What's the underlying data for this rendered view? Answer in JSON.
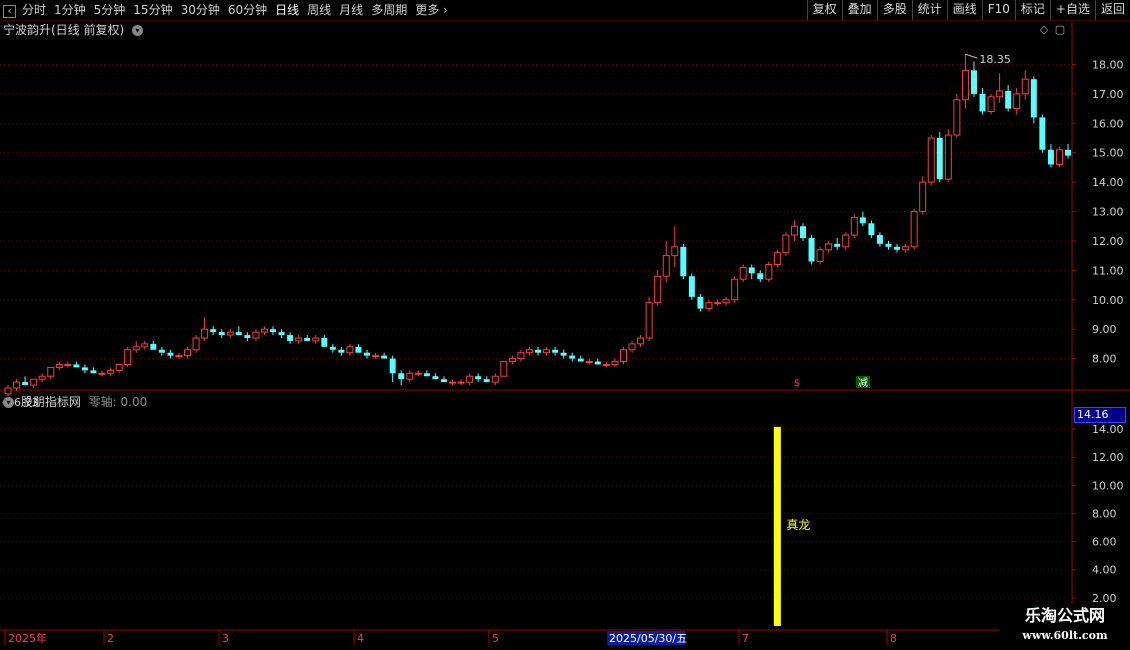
{
  "toolbar": {
    "periods": [
      "分时",
      "1分钟",
      "5分钟",
      "15分钟",
      "30分钟",
      "60分钟",
      "日线",
      "周线",
      "月线",
      "多周期",
      "更多"
    ],
    "active_period": "日线",
    "more_arrow": "›",
    "buttons": [
      "复权",
      "叠加",
      "多股",
      "统计",
      "画线",
      "F10",
      "标记",
      "+自选",
      "返回"
    ]
  },
  "chart": {
    "title": "宁波韵升(日线 前复权)",
    "high_label": "18.35",
    "low_label": "6.73",
    "signal_marks": [
      "$",
      "减"
    ],
    "price_ticks": [
      "18.00",
      "17.00",
      "16.00",
      "15.00",
      "14.00",
      "13.00",
      "12.00",
      "11.00",
      "10.00",
      "9.00",
      "8.00"
    ]
  },
  "indicator": {
    "title": "股朋指标网",
    "zero_axis": "零轴: 0.00",
    "bar_label": "真龙",
    "current_value": "14.16",
    "ticks": [
      "14.00",
      "12.00",
      "10.00",
      "8.00",
      "6.00",
      "4.00",
      "2.00"
    ]
  },
  "time_axis": {
    "labels": [
      "2025年",
      "2",
      "3",
      "4",
      "5",
      "7",
      "8"
    ],
    "highlighted_date": "2025/05/30/五"
  },
  "watermark": {
    "line1": "乐淘公式网",
    "line2": "www.60lt.com"
  },
  "colors": {
    "up": "#ff3c3c",
    "down": "#54ffff",
    "grid": "#5a0000",
    "signal_bar": "#ffff00",
    "label": "#ffff00"
  },
  "chart_data": {
    "type": "candlestick",
    "title": "宁波韵升(日线 前复权)",
    "ylim": [
      7.0,
      18.9
    ],
    "candles": [
      [
        6.8,
        7.1,
        6.73,
        7.0
      ],
      [
        7.0,
        7.3,
        6.9,
        7.2
      ],
      [
        7.2,
        7.4,
        7.1,
        7.1
      ],
      [
        7.1,
        7.3,
        7.0,
        7.3
      ],
      [
        7.3,
        7.5,
        7.2,
        7.4
      ],
      [
        7.4,
        7.7,
        7.3,
        7.7
      ],
      [
        7.7,
        7.9,
        7.6,
        7.8
      ],
      [
        7.8,
        7.9,
        7.7,
        7.8
      ],
      [
        7.8,
        7.9,
        7.7,
        7.7
      ],
      [
        7.7,
        7.8,
        7.5,
        7.6
      ],
      [
        7.6,
        7.7,
        7.5,
        7.5
      ],
      [
        7.5,
        7.6,
        7.4,
        7.5
      ],
      [
        7.5,
        7.7,
        7.4,
        7.6
      ],
      [
        7.6,
        7.8,
        7.5,
        7.8
      ],
      [
        7.8,
        8.4,
        7.7,
        8.3
      ],
      [
        8.3,
        8.6,
        8.2,
        8.4
      ],
      [
        8.4,
        8.6,
        8.3,
        8.5
      ],
      [
        8.5,
        8.6,
        8.3,
        8.3
      ],
      [
        8.3,
        8.4,
        8.1,
        8.2
      ],
      [
        8.2,
        8.3,
        8.0,
        8.1
      ],
      [
        8.1,
        8.2,
        8.0,
        8.1
      ],
      [
        8.1,
        8.4,
        8.0,
        8.3
      ],
      [
        8.3,
        8.8,
        8.2,
        8.7
      ],
      [
        8.7,
        9.4,
        8.6,
        9.0
      ],
      [
        9.0,
        9.1,
        8.8,
        8.9
      ],
      [
        8.9,
        9.0,
        8.7,
        8.8
      ],
      [
        8.8,
        9.0,
        8.7,
        8.9
      ],
      [
        8.9,
        9.1,
        8.8,
        8.8
      ],
      [
        8.8,
        8.9,
        8.6,
        8.7
      ],
      [
        8.7,
        9.0,
        8.6,
        8.9
      ],
      [
        8.9,
        9.1,
        8.8,
        9.0
      ],
      [
        9.0,
        9.1,
        8.8,
        8.9
      ],
      [
        8.9,
        9.0,
        8.7,
        8.8
      ],
      [
        8.8,
        8.9,
        8.5,
        8.6
      ],
      [
        8.6,
        8.8,
        8.5,
        8.7
      ],
      [
        8.7,
        8.8,
        8.6,
        8.6
      ],
      [
        8.6,
        8.8,
        8.5,
        8.7
      ],
      [
        8.7,
        8.8,
        8.4,
        8.4
      ],
      [
        8.4,
        8.5,
        8.2,
        8.3
      ],
      [
        8.3,
        8.4,
        8.1,
        8.2
      ],
      [
        8.2,
        8.5,
        8.1,
        8.4
      ],
      [
        8.4,
        8.5,
        8.2,
        8.2
      ],
      [
        8.2,
        8.3,
        8.0,
        8.1
      ],
      [
        8.1,
        8.2,
        8.0,
        8.1
      ],
      [
        8.1,
        8.2,
        8.0,
        8.0
      ],
      [
        8.0,
        8.1,
        7.2,
        7.5
      ],
      [
        7.5,
        7.6,
        7.1,
        7.3
      ],
      [
        7.3,
        7.6,
        7.2,
        7.5
      ],
      [
        7.5,
        7.6,
        7.4,
        7.5
      ],
      [
        7.5,
        7.6,
        7.4,
        7.4
      ],
      [
        7.4,
        7.5,
        7.3,
        7.3
      ],
      [
        7.3,
        7.4,
        7.2,
        7.2
      ],
      [
        7.2,
        7.3,
        7.1,
        7.2
      ],
      [
        7.2,
        7.3,
        7.1,
        7.2
      ],
      [
        7.2,
        7.5,
        7.1,
        7.4
      ],
      [
        7.4,
        7.5,
        7.2,
        7.3
      ],
      [
        7.3,
        7.4,
        7.2,
        7.2
      ],
      [
        7.2,
        7.5,
        7.1,
        7.4
      ],
      [
        7.4,
        7.9,
        7.4,
        7.9
      ],
      [
        7.9,
        8.1,
        7.8,
        8.0
      ],
      [
        8.0,
        8.3,
        7.9,
        8.2
      ],
      [
        8.2,
        8.4,
        8.1,
        8.3
      ],
      [
        8.3,
        8.4,
        8.1,
        8.2
      ],
      [
        8.2,
        8.4,
        8.1,
        8.3
      ],
      [
        8.3,
        8.4,
        8.1,
        8.2
      ],
      [
        8.2,
        8.3,
        8.0,
        8.1
      ],
      [
        8.1,
        8.2,
        7.9,
        8.0
      ],
      [
        8.0,
        8.1,
        7.9,
        7.9
      ],
      [
        7.9,
        8.0,
        7.8,
        7.9
      ],
      [
        7.9,
        8.0,
        7.8,
        7.8
      ],
      [
        7.8,
        7.9,
        7.7,
        7.8
      ],
      [
        7.8,
        8.0,
        7.7,
        7.9
      ],
      [
        7.9,
        8.4,
        7.8,
        8.3
      ],
      [
        8.3,
        8.6,
        8.2,
        8.5
      ],
      [
        8.5,
        8.8,
        8.4,
        8.7
      ],
      [
        8.7,
        10.1,
        8.6,
        9.9
      ],
      [
        9.9,
        11.0,
        9.8,
        10.8
      ],
      [
        10.8,
        12.0,
        10.6,
        11.5
      ],
      [
        11.5,
        12.5,
        11.1,
        11.8
      ],
      [
        11.8,
        11.9,
        10.7,
        10.8
      ],
      [
        10.8,
        10.9,
        10.0,
        10.1
      ],
      [
        10.1,
        10.2,
        9.6,
        9.7
      ],
      [
        9.7,
        10.0,
        9.6,
        9.9
      ],
      [
        9.9,
        10.0,
        9.8,
        9.9
      ],
      [
        9.9,
        10.1,
        9.8,
        10.0
      ],
      [
        10.0,
        10.8,
        9.9,
        10.7
      ],
      [
        10.7,
        11.2,
        10.6,
        11.1
      ],
      [
        11.1,
        11.2,
        10.7,
        10.9
      ],
      [
        10.9,
        11.0,
        10.6,
        10.7
      ],
      [
        10.7,
        11.3,
        10.6,
        11.2
      ],
      [
        11.2,
        11.7,
        11.1,
        11.6
      ],
      [
        11.6,
        12.3,
        11.5,
        12.2
      ],
      [
        12.2,
        12.7,
        12.0,
        12.5
      ],
      [
        12.5,
        12.6,
        12.0,
        12.1
      ],
      [
        12.1,
        12.2,
        11.2,
        11.3
      ],
      [
        11.3,
        11.8,
        11.2,
        11.7
      ],
      [
        11.7,
        12.0,
        11.6,
        11.9
      ],
      [
        11.9,
        12.1,
        11.7,
        11.8
      ],
      [
        11.8,
        12.3,
        11.7,
        12.2
      ],
      [
        12.2,
        12.9,
        12.1,
        12.8
      ],
      [
        12.8,
        13.0,
        12.5,
        12.6
      ],
      [
        12.6,
        12.7,
        12.1,
        12.2
      ],
      [
        12.2,
        12.3,
        11.8,
        11.9
      ],
      [
        11.9,
        12.0,
        11.7,
        11.8
      ],
      [
        11.8,
        11.9,
        11.6,
        11.7
      ],
      [
        11.7,
        11.9,
        11.6,
        11.8
      ],
      [
        11.8,
        13.1,
        11.7,
        13.0
      ],
      [
        13.0,
        14.2,
        12.9,
        14.0
      ],
      [
        14.0,
        15.6,
        13.9,
        15.5
      ],
      [
        15.5,
        15.7,
        14.0,
        14.1
      ],
      [
        14.1,
        15.8,
        14.0,
        15.6
      ],
      [
        15.6,
        17.0,
        15.5,
        16.8
      ],
      [
        16.8,
        18.35,
        16.5,
        17.8
      ],
      [
        17.8,
        18.1,
        16.9,
        17.0
      ],
      [
        17.0,
        17.2,
        16.3,
        16.4
      ],
      [
        16.4,
        17.0,
        16.3,
        16.9
      ],
      [
        16.9,
        17.7,
        16.7,
        17.1
      ],
      [
        17.1,
        17.3,
        16.4,
        16.5
      ],
      [
        16.5,
        17.2,
        16.3,
        17.0
      ],
      [
        17.0,
        17.8,
        16.8,
        17.5
      ],
      [
        17.5,
        17.6,
        16.0,
        16.2
      ],
      [
        16.2,
        16.3,
        15.0,
        15.1
      ],
      [
        15.1,
        15.3,
        14.5,
        14.6
      ],
      [
        14.6,
        15.2,
        14.5,
        15.1
      ],
      [
        15.1,
        15.3,
        14.8,
        14.9
      ]
    ],
    "indicator": {
      "name": "股朋指标网",
      "ylim": [
        0,
        15.5
      ],
      "signal_index": 90,
      "signal_value": 14.16,
      "label": "真龙"
    }
  }
}
